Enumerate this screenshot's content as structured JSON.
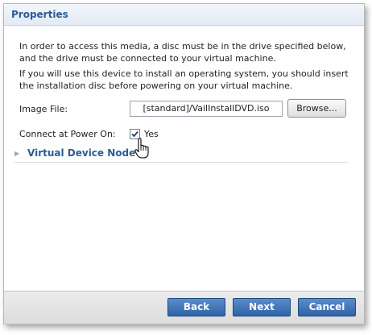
{
  "panel": {
    "title": "Properties"
  },
  "content": {
    "paragraph1": "In order to access this media, a disc must be in the drive specified below, and the drive must be connected to your virtual machine.",
    "paragraph2": "If you will use this device to install an operating system, you should insert the installation disc before powering on your virtual machine.",
    "image_file_label": "Image File:",
    "image_file_value": "[standard]/VailInstallDVD.iso",
    "browse_label": "Browse...",
    "connect_label": "Connect at Power On:",
    "connect_checked": true,
    "connect_value_label": "Yes",
    "section_title": "Virtual Device Node"
  },
  "footer": {
    "back_label": "Back",
    "next_label": "Next",
    "cancel_label": "Cancel"
  },
  "colors": {
    "accent": "#2b5c96",
    "button_blue": "#3a6fb0"
  },
  "icons": {
    "collapse_arrow": "triangle-right-icon",
    "cursor": "hand-pointer-icon"
  }
}
